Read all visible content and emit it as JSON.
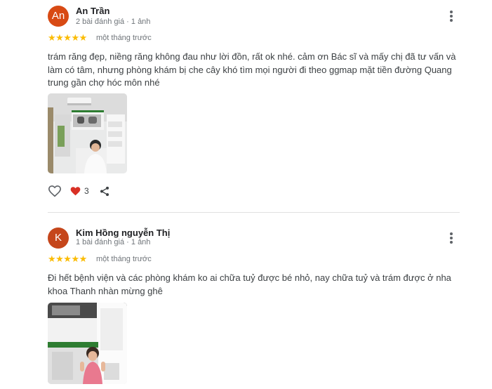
{
  "reviews": [
    {
      "avatar_letter": "An",
      "avatar_color": "#d84a14",
      "name": "An Trần",
      "meta": "2 bài đánh giá · 1 ảnh",
      "stars": "★★★★★",
      "rating": 5,
      "time": "một tháng trước",
      "text": "trám răng đẹp, niềng răng không đau như lời đồn, rất ok nhé. cảm ơn Bác sĩ và mấy chị đã tư vấn và làm có tâm, nhưng phòng khám bị che cây khó tìm mọi người đi theo ggmap mặt tiền đường Quang trung gần chợ hóc môn nhé",
      "like_count": "3"
    },
    {
      "avatar_letter": "K",
      "avatar_color": "#c5461b",
      "name": "Kim Hồng nguyễn Thị",
      "meta": "1 bài đánh giá · 1 ảnh",
      "stars": "★★★★★",
      "rating": 5,
      "time": "một tháng trước",
      "text": "Đi hết bệnh viện và các phòng khám ko ai chữa tuỷ được bé nhỏ, nay chữa tuỷ và trám được ở nha khoa Thanh nhàn mừng ghê"
    }
  ],
  "colors": {
    "star": "#fbbc04",
    "heart": "#d93025",
    "icon": "#5f6368"
  },
  "icons": [
    "more-vert-icon",
    "heart-outline-icon",
    "heart-filled-icon",
    "share-icon"
  ]
}
